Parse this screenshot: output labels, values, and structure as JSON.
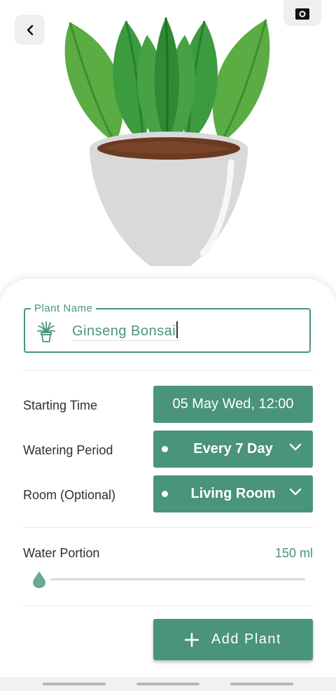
{
  "form": {
    "plant_name_label": "Plant Name",
    "plant_name_value": "Ginseng Bonsai",
    "starting_time_label": "Starting Time",
    "starting_time_value": "05 May Wed, 12:00",
    "watering_period_label": "Watering Period",
    "watering_period_value": "Every 7 Day",
    "room_label": "Room (Optional)",
    "room_value": "Living Room",
    "water_portion_label": "Water Portion",
    "water_portion_value": "150 ml",
    "water_portion_slider_level": 0
  },
  "actions": {
    "add_plant_label": "Add Plant"
  },
  "colors": {
    "accent": "#4a9479",
    "text": "#2f2f2f"
  },
  "icons": [
    "back-arrow-icon",
    "camera-icon",
    "plant-icon",
    "chevron-down-icon",
    "water-drop-icon",
    "plus-icon"
  ]
}
